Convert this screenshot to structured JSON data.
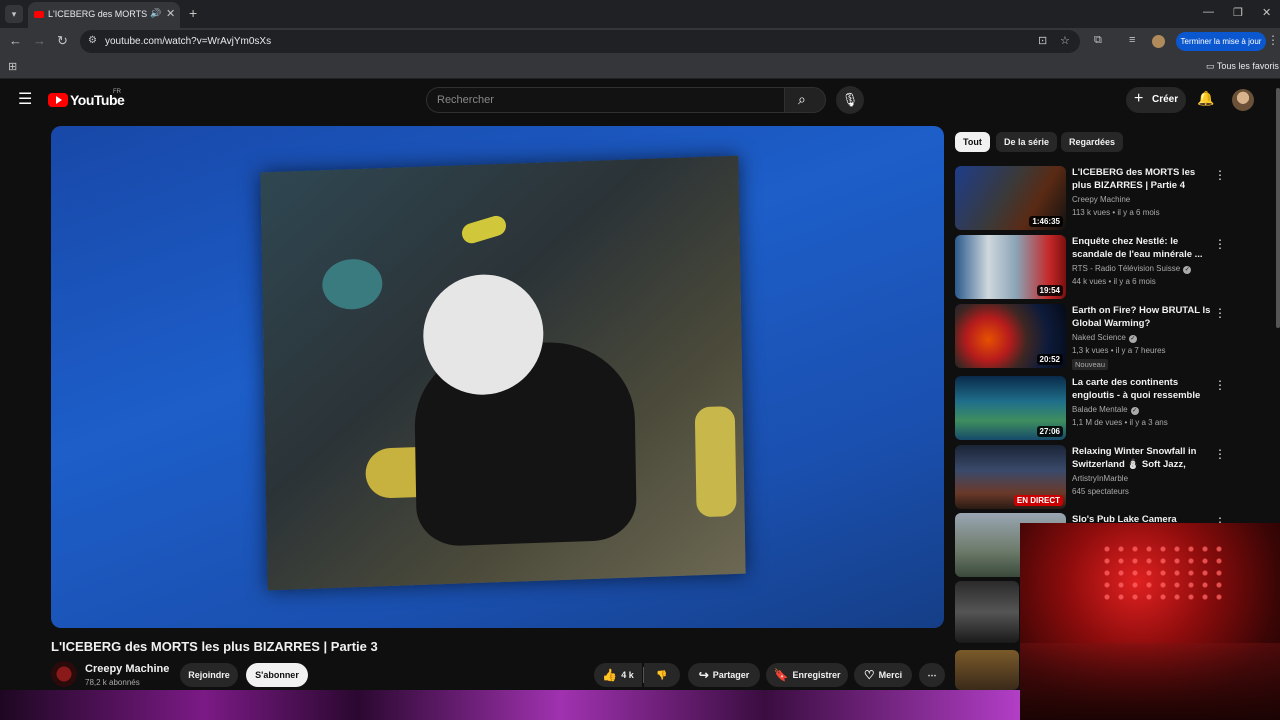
{
  "browser": {
    "tab_title": "L'ICEBERG des MORTS les plus BIZARRES | Partie 3",
    "url": "youtube.com/watch?v=WrAvjYm0sXs",
    "update_button": "Terminer la mise à jour",
    "bookmarks_folder": "Tous les favoris"
  },
  "masthead": {
    "logo_text": "YouTube",
    "country": "FR",
    "search_placeholder": "Rechercher",
    "create_label": "Créer"
  },
  "video": {
    "title": "L'ICEBERG des MORTS les plus BIZARRES | Partie 3",
    "channel": "Creepy Machine",
    "subscribers": "78,2 k abonnés",
    "join_label": "Rejoindre",
    "subscribe_label": "S'abonner",
    "likes": "4 k",
    "share_label": "Partager",
    "save_label": "Enregistrer",
    "thanks_label": "Merci"
  },
  "chips": [
    "Tout",
    "De la série",
    "Regardées"
  ],
  "recommendations": [
    {
      "title": "L'ICEBERG des MORTS les plus BIZARRES | Partie 4",
      "channel": "Creepy Machine",
      "meta": "113 k vues • il y a 6 mois",
      "duration": "1:46:35",
      "verified": false
    },
    {
      "title": "Enquête chez Nestlé: le scandale de l'eau minérale ...",
      "channel": "RTS - Radio Télévision Suisse",
      "meta": "44 k vues • il y a 6 mois",
      "duration": "19:54",
      "verified": true
    },
    {
      "title": "Earth on Fire? How BRUTAL Is Global Warming?",
      "channel": "Naked Science",
      "meta": "1,3 k vues • il y a 7 heures",
      "duration": "20:52",
      "badge": "Nouveau",
      "verified": true
    },
    {
      "title": "La carte des continents engloutis - à quoi ressemble la...",
      "channel": "Balade Mentale",
      "meta": "1,1 M de vues • il y a 3 ans",
      "duration": "27:06",
      "verified": true
    },
    {
      "title": "Relaxing Winter Snowfall in Switzerland ⛄ Soft Jazz, Coz...",
      "channel": "ArtistryInMarble",
      "meta": "645 spectateurs",
      "live": "EN DIRECT",
      "verified": false
    },
    {
      "title": "Slo's Pub Lake Camera",
      "channel": "",
      "meta": "",
      "verified": false
    }
  ]
}
